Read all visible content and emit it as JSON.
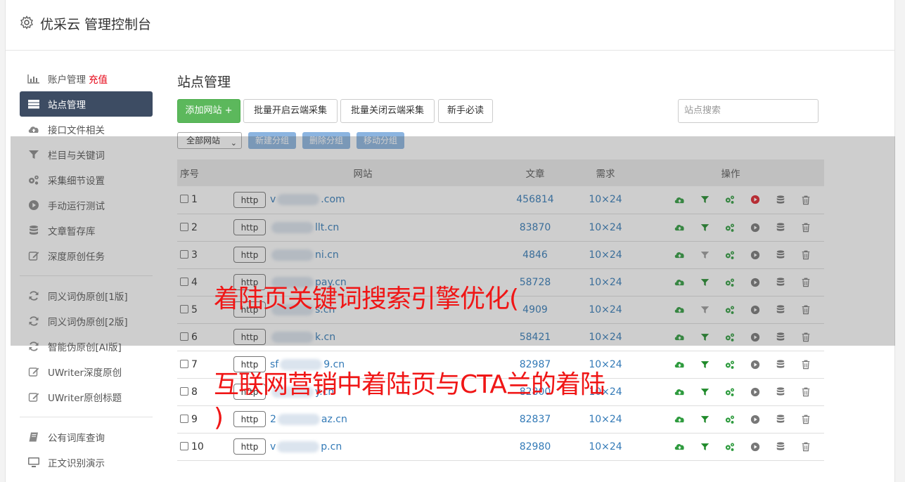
{
  "header": {
    "title": "优采云 管理控制台"
  },
  "sidebar": {
    "items": [
      {
        "label": "账户管理",
        "extra": "充值",
        "icon": "bar-chart-icon"
      },
      {
        "label": "站点管理",
        "icon": "server-list-icon",
        "active": true
      },
      {
        "label": "接口文件相关",
        "icon": "cloud-upload-icon"
      },
      {
        "label": "栏目与关键词",
        "icon": "filter-icon"
      },
      {
        "label": "采集细节设置",
        "icon": "gears-icon"
      },
      {
        "label": "手动运行测试",
        "icon": "play-circle-icon"
      },
      {
        "label": "文章暂存库",
        "icon": "database-icon"
      },
      {
        "label": "深度原创任务",
        "icon": "edit-icon"
      }
    ],
    "items2": [
      {
        "label": "同义词伪原创[1版]",
        "icon": "refresh-icon"
      },
      {
        "label": "同义词伪原创[2版]",
        "icon": "refresh-icon"
      },
      {
        "label": "智能伪原创[AI版]",
        "icon": "refresh-icon"
      },
      {
        "label": "UWriter深度原创",
        "icon": "edit-icon"
      },
      {
        "label": "UWriter原创标题",
        "icon": "edit-icon"
      }
    ],
    "items3": [
      {
        "label": "公有词库查询",
        "icon": "book-icon"
      },
      {
        "label": "正文识别演示",
        "icon": "monitor-icon"
      }
    ]
  },
  "main": {
    "title": "站点管理",
    "toolbar": {
      "add": "添加网站 +",
      "batch_open": "批量开启云端采集",
      "batch_close": "批量关闭云端采集",
      "newbie": "新手必读",
      "search_placeholder": "站点搜索"
    },
    "toolbar2": {
      "select": "全部网站",
      "new_group": "新建分组",
      "delete_group": "删除分组",
      "move_group": "移动分组"
    },
    "table": {
      "headers": [
        "序号",
        "网站",
        "文章",
        "需求",
        "操作"
      ],
      "rows": [
        {
          "no": "1",
          "proto": "http",
          "prefix": "v",
          "suffix": ".com",
          "articles": "456814",
          "req": "10×24",
          "filter_active": true,
          "run_active": true
        },
        {
          "no": "2",
          "proto": "http",
          "prefix": "",
          "suffix": "llt.cn",
          "articles": "83870",
          "req": "10×24",
          "filter_active": true,
          "run_active": false
        },
        {
          "no": "3",
          "proto": "http",
          "prefix": "",
          "suffix": "ni.cn",
          "articles": "4846",
          "req": "10×24",
          "filter_active": false,
          "run_active": false
        },
        {
          "no": "4",
          "proto": "http",
          "prefix": "",
          "suffix": "pay.cn",
          "articles": "58728",
          "req": "10×24",
          "filter_active": true,
          "run_active": false
        },
        {
          "no": "5",
          "proto": "http",
          "prefix": "",
          "suffix": "s.cn",
          "articles": "4909",
          "req": "10×24",
          "filter_active": false,
          "run_active": false
        },
        {
          "no": "6",
          "proto": "http",
          "prefix": "",
          "suffix": "k.cn",
          "articles": "58421",
          "req": "10×24",
          "filter_active": true,
          "run_active": false
        },
        {
          "no": "7",
          "proto": "http",
          "prefix": "sf",
          "suffix": "9.cn",
          "articles": "82987",
          "req": "10×24",
          "filter_active": true,
          "run_active": false
        },
        {
          "no": "8",
          "proto": "http",
          "prefix": "",
          "suffix": "y.cn",
          "articles": "82800",
          "req": "10×24",
          "filter_active": true,
          "run_active": false
        },
        {
          "no": "9",
          "proto": "http",
          "prefix": "2",
          "suffix": "az.cn",
          "articles": "82837",
          "req": "10×24",
          "filter_active": true,
          "run_active": false
        },
        {
          "no": "10",
          "proto": "http",
          "prefix": "v",
          "suffix": "p.cn",
          "articles": "82980",
          "req": "10×24",
          "filter_active": true,
          "run_active": false
        }
      ]
    }
  },
  "overlay": {
    "line1": "着陆页关键词搜索引擎优化(",
    "line2": "互联网营销中着陆页与CTA兰的着陆",
    "line3": ")"
  },
  "colors": {
    "accent": "#3d4c63",
    "green": "#5cb85c",
    "link": "#337ab7",
    "group_btn": "#8bb4e0",
    "ad_text": "#f01616"
  }
}
